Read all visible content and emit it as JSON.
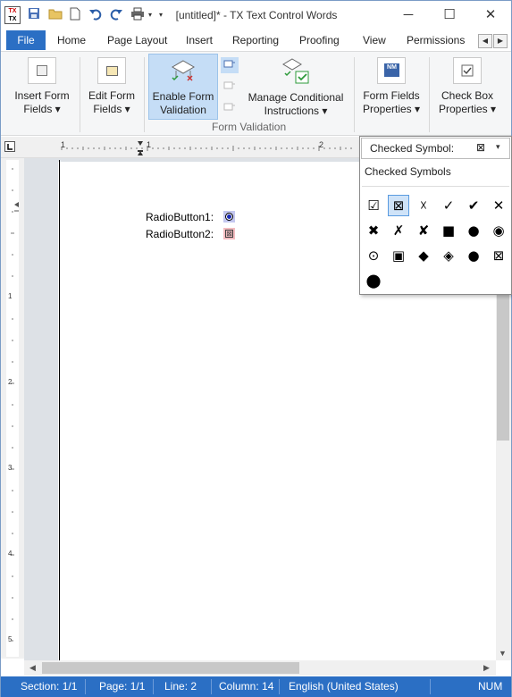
{
  "titlebar": {
    "app_icon_text_top": "TX",
    "app_icon_text_bottom": "TX",
    "title": "[untitled]* - TX Text Control Words",
    "minimize": "─",
    "maximize": "☐",
    "close": "✕"
  },
  "menu": {
    "file": "File",
    "tabs": [
      "Home",
      "Page Layout",
      "Insert",
      "Reporting",
      "Proofing",
      "View",
      "Permissions"
    ],
    "scroll_left": "◀",
    "scroll_right": "▶"
  },
  "ribbon": {
    "insert_form_fields": [
      "Insert Form",
      "Fields ▾"
    ],
    "edit_form_fields": [
      "Edit Form",
      "Fields ▾"
    ],
    "enable_form_validation": [
      "Enable Form",
      "Validation"
    ],
    "manage_conditional": [
      "Manage Conditional",
      "Instructions ▾"
    ],
    "form_fields_properties": [
      "Form Fields",
      "Properties ▾"
    ],
    "check_box_properties": [
      "Check Box",
      "Properties ▾"
    ],
    "group_label": "Form Validation",
    "form_fields_icon_text": "NM"
  },
  "ruler": {
    "marks": [
      "1",
      "1",
      "2"
    ]
  },
  "vruler": {
    "marks": [
      "1",
      "2",
      "3",
      "4",
      "5"
    ]
  },
  "document": {
    "radio1_label": "RadioButton1:",
    "radio2_label": "RadioButton2:",
    "radio2_symbol": "⊠"
  },
  "popup": {
    "combo_label": "Checked Symbol:",
    "combo_value": "⊠",
    "combo_arrow": "▾",
    "heading": "Checked Symbols",
    "symbols": [
      "☑",
      "⊠",
      "☓",
      "✓",
      "✔",
      "✕",
      "✖",
      "✗",
      "✘",
      "■",
      "●",
      "◉",
      "⊙",
      "▣",
      "◆",
      "◈",
      "●",
      "⊠",
      "⬤"
    ],
    "selected_index": 1
  },
  "status": {
    "section": "Section: 1/1",
    "page": "Page: 1/1",
    "line": "Line: 2",
    "column": "Column: 14",
    "language": "English (United States)",
    "num": "NUM"
  }
}
